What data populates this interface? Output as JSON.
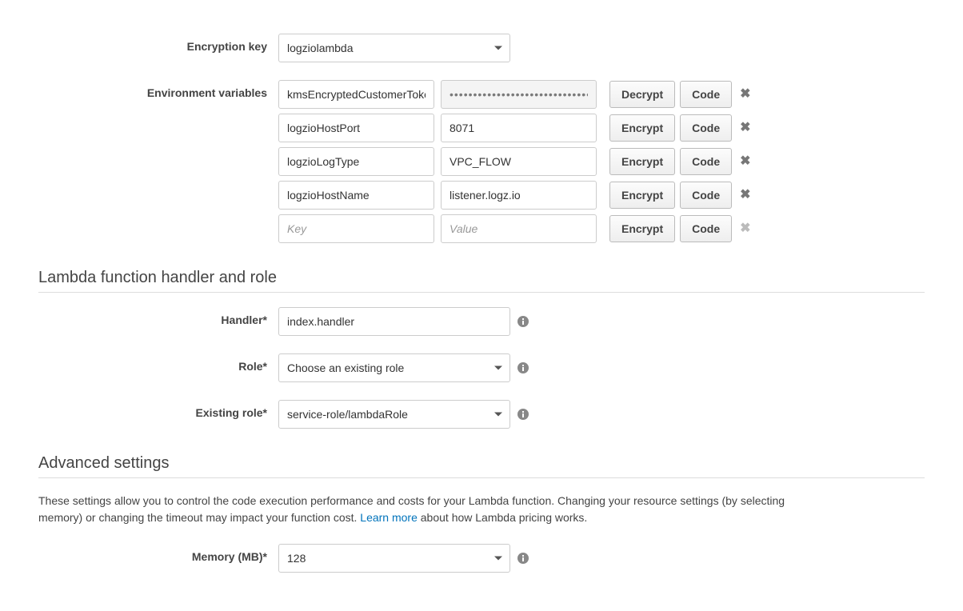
{
  "encryption_key": {
    "label": "Encryption key",
    "value": "logziolambda"
  },
  "env_vars": {
    "label": "Environment variables",
    "rows": [
      {
        "key": "kmsEncryptedCustomerToken",
        "value": "••••••••••••••••••••••••••••••••••••",
        "encrypted": true,
        "crypt_label": "Decrypt",
        "code_label": "Code"
      },
      {
        "key": "logzioHostPort",
        "value": "8071",
        "encrypted": false,
        "crypt_label": "Encrypt",
        "code_label": "Code"
      },
      {
        "key": "logzioLogType",
        "value": "VPC_FLOW",
        "encrypted": false,
        "crypt_label": "Encrypt",
        "code_label": "Code"
      },
      {
        "key": "logzioHostName",
        "value": "listener.logz.io",
        "encrypted": false,
        "crypt_label": "Encrypt",
        "code_label": "Code"
      }
    ],
    "blank_row": {
      "key_placeholder": "Key",
      "value_placeholder": "Value",
      "crypt_label": "Encrypt",
      "code_label": "Code"
    }
  },
  "handler_section": {
    "title": "Lambda function handler and role",
    "handler_label": "Handler*",
    "handler_value": "index.handler",
    "role_label": "Role*",
    "role_value": "Choose an existing role",
    "existing_role_label": "Existing role*",
    "existing_role_value": "service-role/lambdaRole"
  },
  "advanced": {
    "title": "Advanced settings",
    "description_pre": "These settings allow you to control the code execution performance and costs for your Lambda function. Changing your resource settings (by selecting memory) or changing the timeout may impact your function cost. ",
    "learn_more": "Learn more",
    "description_post": " about how Lambda pricing works.",
    "memory_label": "Memory (MB)*",
    "memory_value": "128"
  }
}
